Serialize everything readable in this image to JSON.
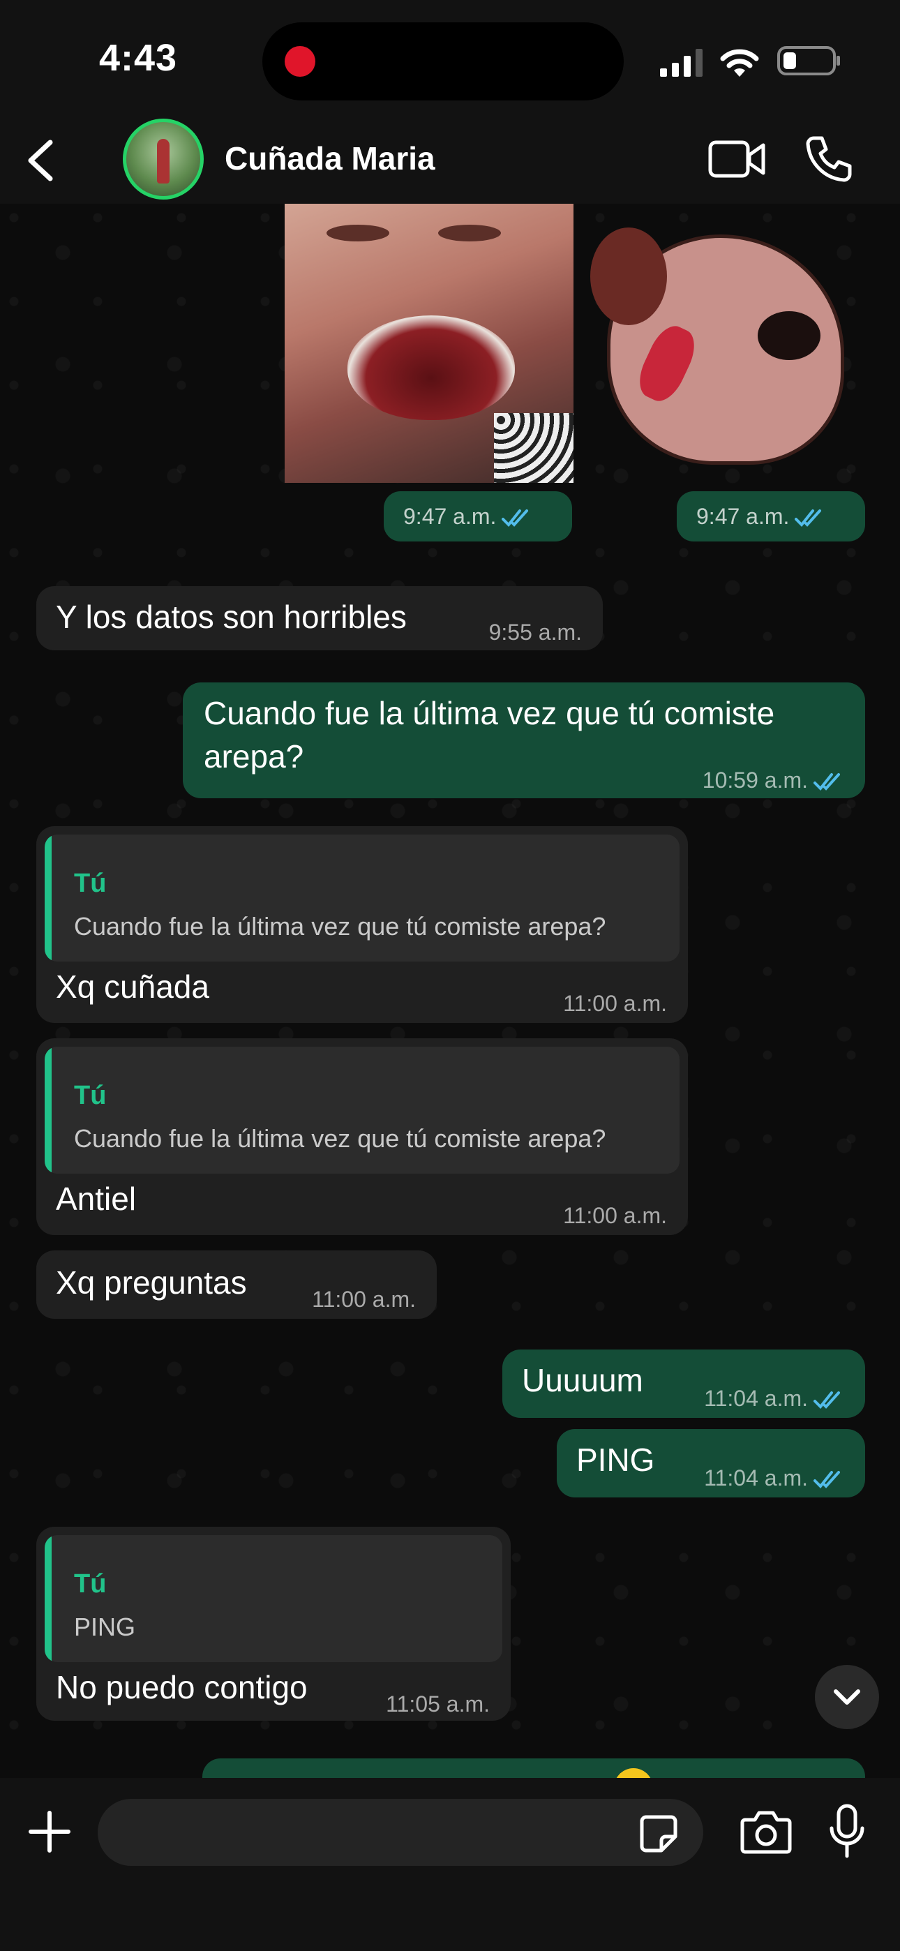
{
  "status_bar": {
    "time": "4:43"
  },
  "header": {
    "contact_name": "Cuñada Maria"
  },
  "chat": {
    "media_times": [
      "9:47 a.m.",
      "9:47 a.m."
    ],
    "messages": [
      {
        "dir": "in",
        "text": "Y los datos son horribles",
        "time": "9:55 a.m."
      },
      {
        "dir": "out",
        "text_line1": "Cuando fue la última vez que tú comiste",
        "text_line2": "arepa?",
        "time": "10:59 a.m."
      },
      {
        "dir": "in",
        "quote_author": "Tú",
        "quote_text": "Cuando fue la última vez que tú comiste arepa?",
        "text": "Xq cuñada",
        "time": "11:00 a.m."
      },
      {
        "dir": "in",
        "quote_author": "Tú",
        "quote_text": "Cuando fue la última vez que tú comiste arepa?",
        "text": "Antiel",
        "time": "11:00 a.m."
      },
      {
        "dir": "in",
        "text": "Xq preguntas",
        "time": "11:00 a.m."
      },
      {
        "dir": "out",
        "text": "Uuuuum",
        "time": "11:04 a.m."
      },
      {
        "dir": "out",
        "text": "PING",
        "time": "11:04 a.m."
      },
      {
        "dir": "in",
        "quote_author": "Tú",
        "quote_text": "PING",
        "text": "No puedo contigo",
        "time": "11:05 a.m."
      }
    ]
  },
  "composer": {
    "placeholder": ""
  },
  "icons": {
    "back": "chevron-left-icon",
    "video": "video-camera-icon",
    "call": "phone-icon",
    "plus": "plus-icon",
    "sticker": "sticker-icon",
    "camera": "camera-icon",
    "mic": "microphone-icon",
    "scroll_down": "chevron-down-icon",
    "read": "double-check-icon"
  },
  "colors": {
    "outgoing_bubble": "#144d37",
    "incoming_bubble": "#202020",
    "accent": "#21c38a",
    "read_ticks": "#53bdeb",
    "record_dot": "#e0152a"
  }
}
